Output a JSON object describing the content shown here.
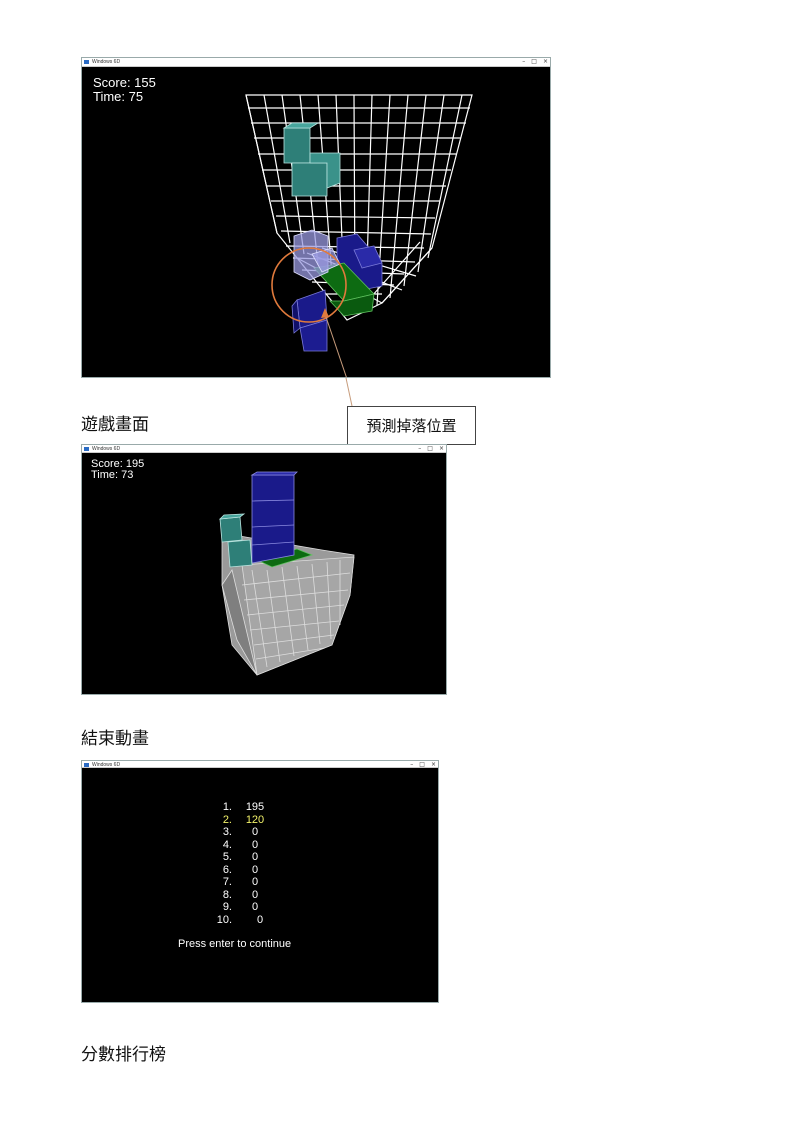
{
  "window_title": "Windows 6D",
  "window_buttons": [
    "–",
    "□",
    "×"
  ],
  "screen1": {
    "score": "Score: 155",
    "time": "Time: 75"
  },
  "screen2": {
    "score": "Score: 195",
    "time": "Time: 73"
  },
  "captions": {
    "game_screen": "遊戲畫面",
    "prediction": "預測掉落位置",
    "end_animation": "結束動畫",
    "leaderboard": "分數排行榜"
  },
  "leaderboard": {
    "rows": [
      {
        "rank": "1.",
        "score": "195"
      },
      {
        "rank": "2.",
        "score": "120"
      },
      {
        "rank": "3.",
        "score": "0"
      },
      {
        "rank": "4.",
        "score": "0"
      },
      {
        "rank": "5.",
        "score": "0"
      },
      {
        "rank": "6.",
        "score": "0"
      },
      {
        "rank": "7.",
        "score": "0"
      },
      {
        "rank": "8.",
        "score": "0"
      },
      {
        "rank": "9.",
        "score": "0"
      },
      {
        "rank": "10.",
        "score": "0"
      }
    ],
    "highlight_index": 1,
    "highlight_color": "#f2f26a",
    "prompt": "Press enter to continue"
  },
  "colors": {
    "well_grid": "#ffffff",
    "teal_block": "#2e7f78",
    "blue_block": "#1a1a8a",
    "green_block": "#0d6b12",
    "gray_block": "#9a9a9a",
    "annotation_circle": "#e07a3c"
  }
}
